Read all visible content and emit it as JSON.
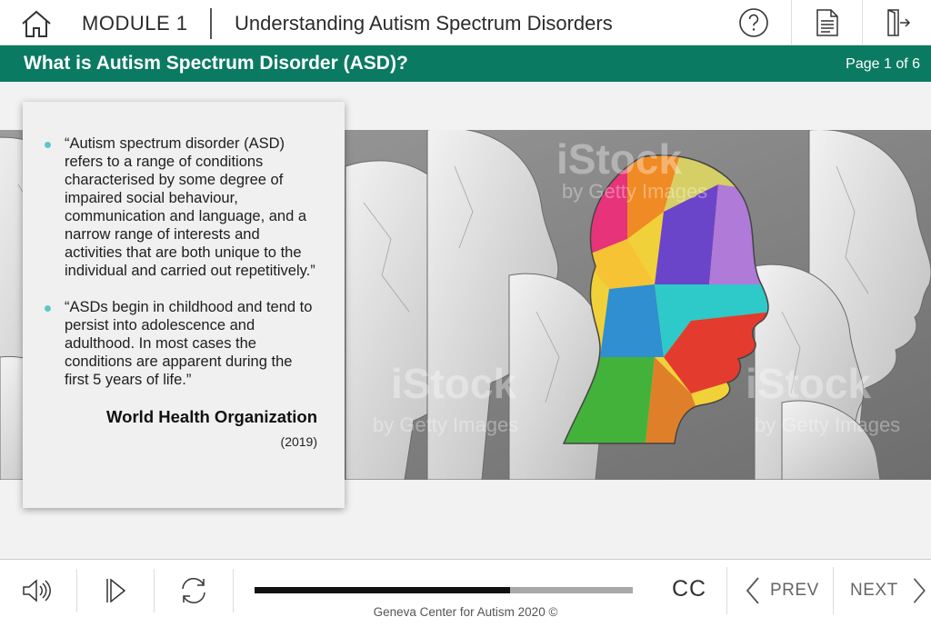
{
  "header": {
    "module_label": "MODULE 1",
    "course_title": "Understanding Autism Spectrum Disorders",
    "icons": {
      "home": "home-icon",
      "help": "help-circle-icon",
      "document": "document-icon",
      "exit": "exit-door-icon"
    }
  },
  "slide": {
    "heading": "What is Autism Spectrum Disorder (ASD)?",
    "page_counter": "Page 1 of 6",
    "quotes": [
      "“Autism spectrum disorder (ASD) refers to a range of conditions characterised by some degree of impaired social behaviour, communication and language, and a narrow range of interests and activities that are both unique to the individual and carried out repetitively.”",
      "“ASDs begin in childhood and tend to persist into adolescence and adulthood. In most cases the conditions are apparent during the first 5 years of life.”"
    ],
    "attribution": "World Health Organization",
    "year": "(2019)",
    "image": {
      "watermark_brand": "iStock",
      "watermark_by": "by Getty Images"
    }
  },
  "player": {
    "progress_fraction": 0.675,
    "cc_label": "CC",
    "prev_label": "PREV",
    "next_label": "NEXT",
    "footer": "Geneva Center for Autism 2020 ©",
    "icons": {
      "volume": "volume-icon",
      "play": "play-icon",
      "replay": "replay-icon",
      "prev": "chevron-left-icon",
      "next": "chevron-right-icon"
    }
  },
  "colors": {
    "accent_green": "#0a7a62",
    "bullet": "#5fc6c8"
  }
}
